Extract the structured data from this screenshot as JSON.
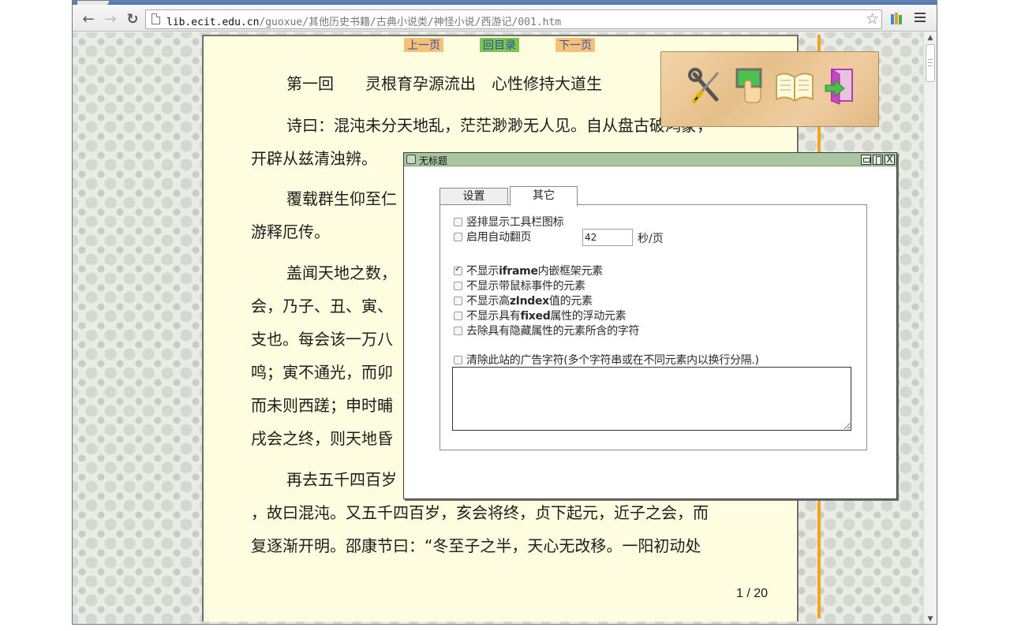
{
  "browser": {
    "back_glyph": "←",
    "forward_glyph": "→",
    "reload_glyph": "↻",
    "url_host": "lib.ecit.edu.cn",
    "url_path": "/guoxue/其他历史书籍/古典小说类/神怪小说/西游记/001.htm",
    "bookmark_glyph": "☆"
  },
  "reader": {
    "nav": {
      "prev": "上一页",
      "toc": "回目录",
      "next": "下一页"
    },
    "lines": [
      "第一回　　灵根育孕源流出　心性修持大道生",
      "诗曰：混沌未分天地乱，茫茫渺渺无人见。自从盘古破鸿蒙，",
      "开辟从兹清浊辨。",
      "覆载群生仰至仁",
      "游释厄传。",
      "盖闻天地之数，",
      "会，乃子、丑、寅、",
      "支也。每会该一万八",
      "鸣；寅不通光，而卯",
      "而未则西蹉；申时晡",
      "戌会之终，则天地昏",
      "再去五千四百岁",
      "，故曰混沌。又五千四百岁，亥会将终，贞下起元，近子之会，而",
      "复逐渐开明。邵康节曰：“冬至子之半，天心无改移。一阳初动处"
    ],
    "page_indicator": "1 / 20"
  },
  "tool_panel": {
    "icons": [
      "settings-tools-icon",
      "select-element-icon",
      "reading-mode-icon",
      "exit-icon"
    ]
  },
  "dialog": {
    "title": "无标题",
    "close_glyph": "X",
    "tabs": [
      "设置",
      "其它"
    ],
    "active_tab": "其它",
    "options": {
      "vertical_toolbar": {
        "label": "竖排显示工具栏图标",
        "checked": false
      },
      "auto_page": {
        "label": "启用自动翻页",
        "checked": false
      },
      "auto_page_seconds": "42",
      "auto_page_unit": "秒/页",
      "hide_iframe": {
        "pre": "不显示",
        "bold": "iframe",
        "post": "内嵌框架元素",
        "checked": true
      },
      "hide_mouse_events": {
        "label": "不显示带鼠标事件的元素",
        "checked": false
      },
      "hide_zindex": {
        "pre": "不显示高",
        "bold": "zIndex",
        "post": "值的元素",
        "checked": false
      },
      "hide_fixed": {
        "pre": "不显示具有",
        "bold": "fixed",
        "post": "属性的浮动元素",
        "checked": false
      },
      "remove_hidden_chars": {
        "label": "去除具有隐藏属性的元素所含的字符",
        "checked": false
      },
      "clear_ad_chars": {
        "label": "清除此站的广告字符(多个字符串或在不同元素内以换行分隔.)",
        "checked": false
      },
      "ad_chars_value": ""
    }
  },
  "colors": {
    "page_bg": "#fffde0",
    "nav_orange": "#f5c176",
    "nav_green": "#7ec64b",
    "dialog_title": "#a8c7a0",
    "gold_bar": "#f3a31e"
  }
}
